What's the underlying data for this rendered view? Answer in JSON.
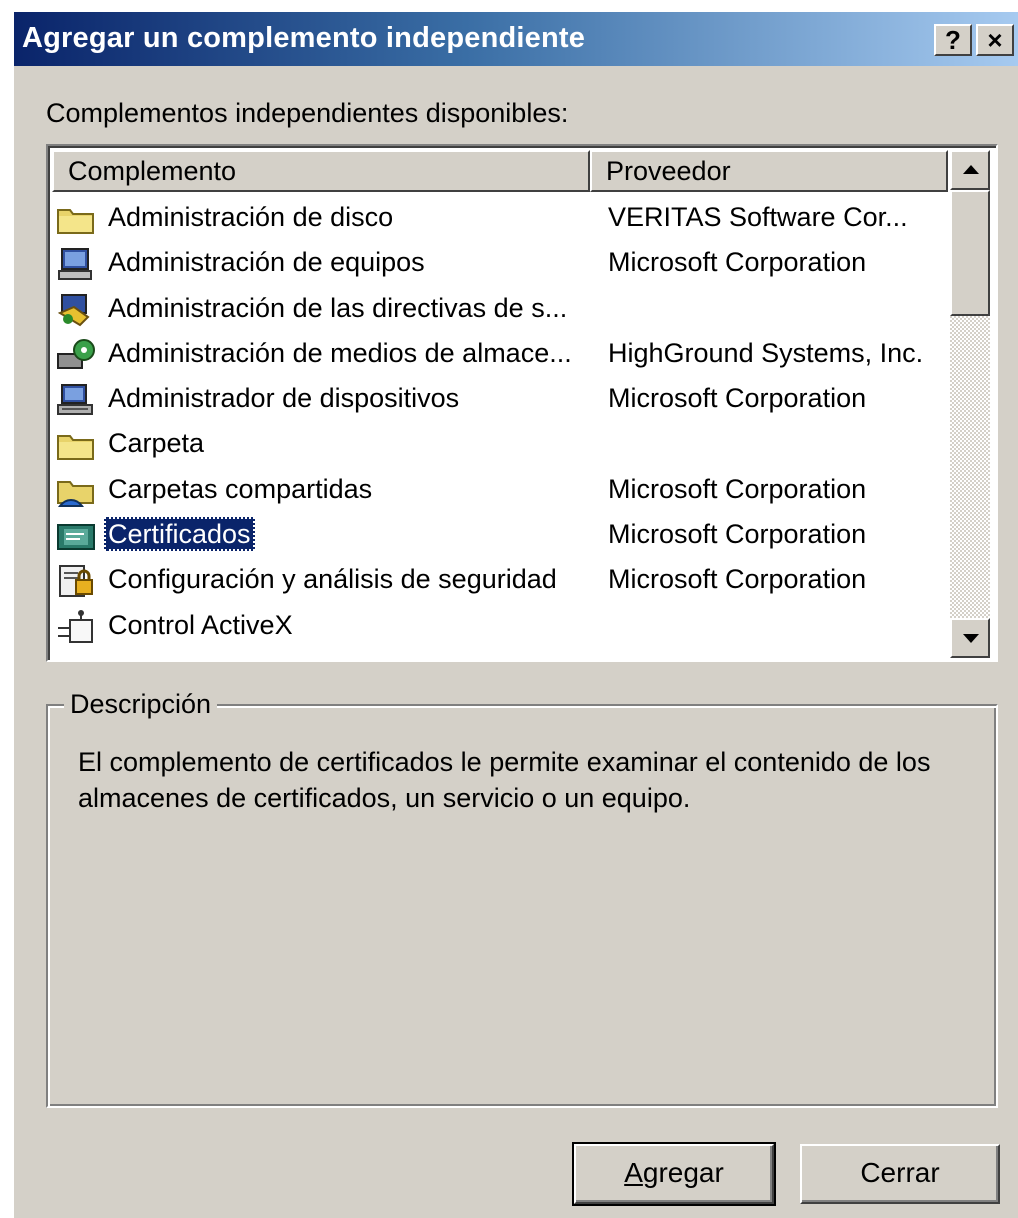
{
  "dialog": {
    "title": "Agregar un complemento independiente",
    "help_label": "?",
    "close_label": "×"
  },
  "available_label": "Complementos independientes disponibles:",
  "list": {
    "columns": [
      "Complemento",
      "Proveedor"
    ],
    "rows": [
      {
        "name": "Administración de disco",
        "vendor": "VERITAS Software Cor...",
        "icon": "folder-icon"
      },
      {
        "name": "Administración de equipos",
        "vendor": "Microsoft Corporation",
        "icon": "computer-management-icon"
      },
      {
        "name": "Administración de las directivas de s...",
        "vendor": "",
        "icon": "policy-icon"
      },
      {
        "name": "Administración de medios de almace...",
        "vendor": "HighGround Systems, Inc.",
        "icon": "storage-media-icon"
      },
      {
        "name": "Administrador de dispositivos",
        "vendor": "Microsoft Corporation",
        "icon": "device-manager-icon"
      },
      {
        "name": "Carpeta",
        "vendor": "",
        "icon": "folder-icon"
      },
      {
        "name": "Carpetas compartidas",
        "vendor": "Microsoft Corporation",
        "icon": "shared-folder-icon"
      },
      {
        "name": "Certificados",
        "vendor": "Microsoft Corporation",
        "icon": "certificates-icon",
        "selected": true
      },
      {
        "name": "Configuración y análisis de seguridad",
        "vendor": "Microsoft Corporation",
        "icon": "security-config-icon"
      },
      {
        "name": "Control ActiveX",
        "vendor": "",
        "icon": "activex-icon"
      }
    ]
  },
  "description": {
    "legend": "Descripción",
    "text": "El complemento de certificados le permite  examinar el contenido de los almacenes de certificados, un servicio o un equipo."
  },
  "buttons": {
    "add_accel": "A",
    "add_rest": "gregar",
    "close": "Cerrar"
  },
  "colors": {
    "selection": "#0a246a",
    "title_gradient_start": "#0a246a",
    "title_gradient_end": "#a6caf0",
    "face": "#d4d0c8"
  }
}
